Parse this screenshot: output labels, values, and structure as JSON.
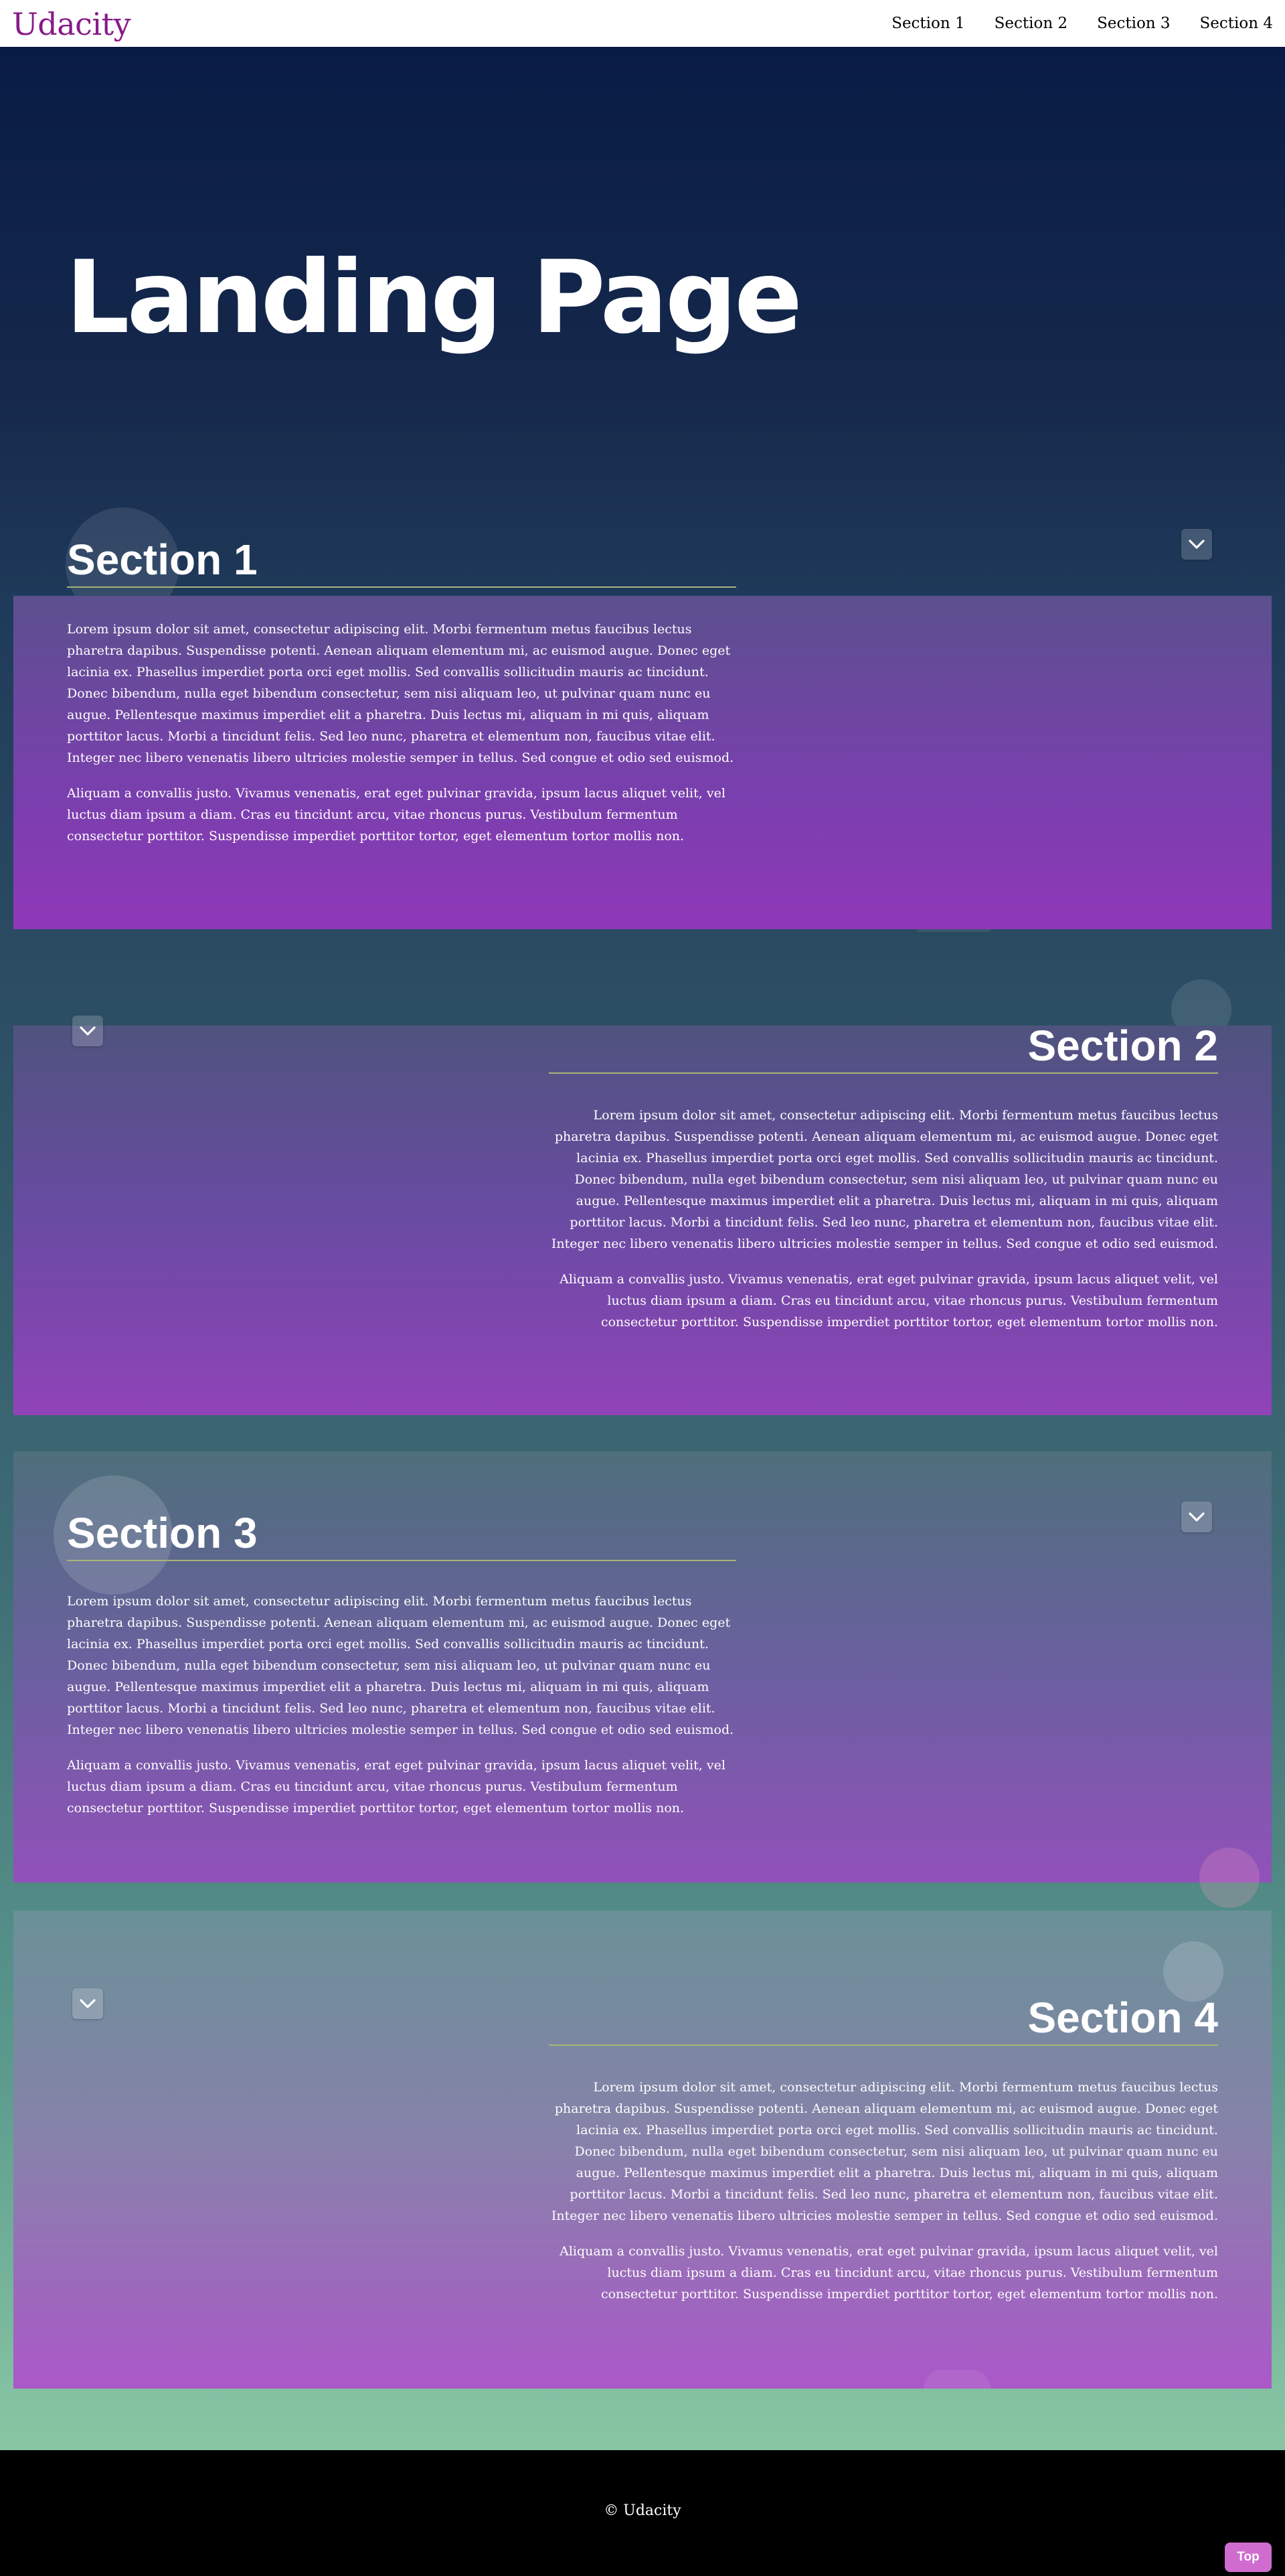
{
  "navbar": {
    "logo": "Udacity",
    "links": [
      "Section 1",
      "Section 2",
      "Section 3",
      "Section 4"
    ]
  },
  "hero": {
    "title": "Landing Page"
  },
  "sections": [
    {
      "title": "Section 1",
      "paragraphs": [
        "Lorem ipsum dolor sit amet, consectetur adipiscing elit. Morbi fermentum metus faucibus lectus pharetra dapibus. Suspendisse potenti. Aenean aliquam elementum mi, ac euismod augue. Donec eget lacinia ex. Phasellus imperdiet porta orci eget mollis. Sed convallis sollicitudin mauris ac tincidunt. Donec bibendum, nulla eget bibendum consectetur, sem nisi aliquam leo, ut pulvinar quam nunc eu augue. Pellentesque maximus imperdiet elit a pharetra. Duis lectus mi, aliquam in mi quis, aliquam porttitor lacus. Morbi a tincidunt felis. Sed leo nunc, pharetra et elementum non, faucibus vitae elit. Integer nec libero venenatis libero ultricies molestie semper in tellus. Sed congue et odio sed euismod.",
        "Aliquam a convallis justo. Vivamus venenatis, erat eget pulvinar gravida, ipsum lacus aliquet velit, vel luctus diam ipsum a diam. Cras eu tincidunt arcu, vitae rhoncus purus. Vestibulum fermentum consectetur porttitor. Suspendisse imperdiet porttitor tortor, eget elementum tortor mollis non."
      ]
    },
    {
      "title": "Section 2",
      "paragraphs": [
        "Lorem ipsum dolor sit amet, consectetur adipiscing elit. Morbi fermentum metus faucibus lectus pharetra dapibus. Suspendisse potenti. Aenean aliquam elementum mi, ac euismod augue. Donec eget lacinia ex. Phasellus imperdiet porta orci eget mollis. Sed convallis sollicitudin mauris ac tincidunt. Donec bibendum, nulla eget bibendum consectetur, sem nisi aliquam leo, ut pulvinar quam nunc eu augue. Pellentesque maximus imperdiet elit a pharetra. Duis lectus mi, aliquam in mi quis, aliquam porttitor lacus. Morbi a tincidunt felis. Sed leo nunc, pharetra et elementum non, faucibus vitae elit. Integer nec libero venenatis libero ultricies molestie semper in tellus. Sed congue et odio sed euismod.",
        "Aliquam a convallis justo. Vivamus venenatis, erat eget pulvinar gravida, ipsum lacus aliquet velit, vel luctus diam ipsum a diam. Cras eu tincidunt arcu, vitae rhoncus purus. Vestibulum fermentum consectetur porttitor. Suspendisse imperdiet porttitor tortor, eget elementum tortor mollis non."
      ]
    },
    {
      "title": "Section 3",
      "paragraphs": [
        "Lorem ipsum dolor sit amet, consectetur adipiscing elit. Morbi fermentum metus faucibus lectus pharetra dapibus. Suspendisse potenti. Aenean aliquam elementum mi, ac euismod augue. Donec eget lacinia ex. Phasellus imperdiet porta orci eget mollis. Sed convallis sollicitudin mauris ac tincidunt. Donec bibendum, nulla eget bibendum consectetur, sem nisi aliquam leo, ut pulvinar quam nunc eu augue. Pellentesque maximus imperdiet elit a pharetra. Duis lectus mi, aliquam in mi quis, aliquam porttitor lacus. Morbi a tincidunt felis. Sed leo nunc, pharetra et elementum non, faucibus vitae elit. Integer nec libero venenatis libero ultricies molestie semper in tellus. Sed congue et odio sed euismod.",
        "Aliquam a convallis justo. Vivamus venenatis, erat eget pulvinar gravida, ipsum lacus aliquet velit, vel luctus diam ipsum a diam. Cras eu tincidunt arcu, vitae rhoncus purus. Vestibulum fermentum consectetur porttitor. Suspendisse imperdiet porttitor tortor, eget elementum tortor mollis non."
      ]
    },
    {
      "title": "Section 4",
      "paragraphs": [
        "Lorem ipsum dolor sit amet, consectetur adipiscing elit. Morbi fermentum metus faucibus lectus pharetra dapibus. Suspendisse potenti. Aenean aliquam elementum mi, ac euismod augue. Donec eget lacinia ex. Phasellus imperdiet porta orci eget mollis. Sed convallis sollicitudin mauris ac tincidunt. Donec bibendum, nulla eget bibendum consectetur, sem nisi aliquam leo, ut pulvinar quam nunc eu augue. Pellentesque maximus imperdiet elit a pharetra. Duis lectus mi, aliquam in mi quis, aliquam porttitor lacus. Morbi a tincidunt felis. Sed leo nunc, pharetra et elementum non, faucibus vitae elit. Integer nec libero venenatis libero ultricies molestie semper in tellus. Sed congue et odio sed euismod.",
        "Aliquam a convallis justo. Vivamus venenatis, erat eget pulvinar gravida, ipsum lacus aliquet velit, vel luctus diam ipsum a diam. Cras eu tincidunt arcu, vitae rhoncus purus. Vestibulum fermentum consectetur porttitor. Suspendisse imperdiet porttitor tortor, eget elementum tortor mollis non."
      ]
    }
  ],
  "icons": {
    "collapse": "chevron-down-icon"
  },
  "footer": {
    "copyright": "© Udacity"
  },
  "top_button": {
    "label": "Top"
  },
  "colors": {
    "logo": "#881a8a",
    "hero_background": "#071a44",
    "page_bottom_background": "#84c3a2",
    "section_panel_top": "#5e5096",
    "section_panel_bottom": "#9641bb",
    "heading_rule": "#a7b478",
    "footer": "#000000",
    "top_button": "#d06ccf"
  }
}
